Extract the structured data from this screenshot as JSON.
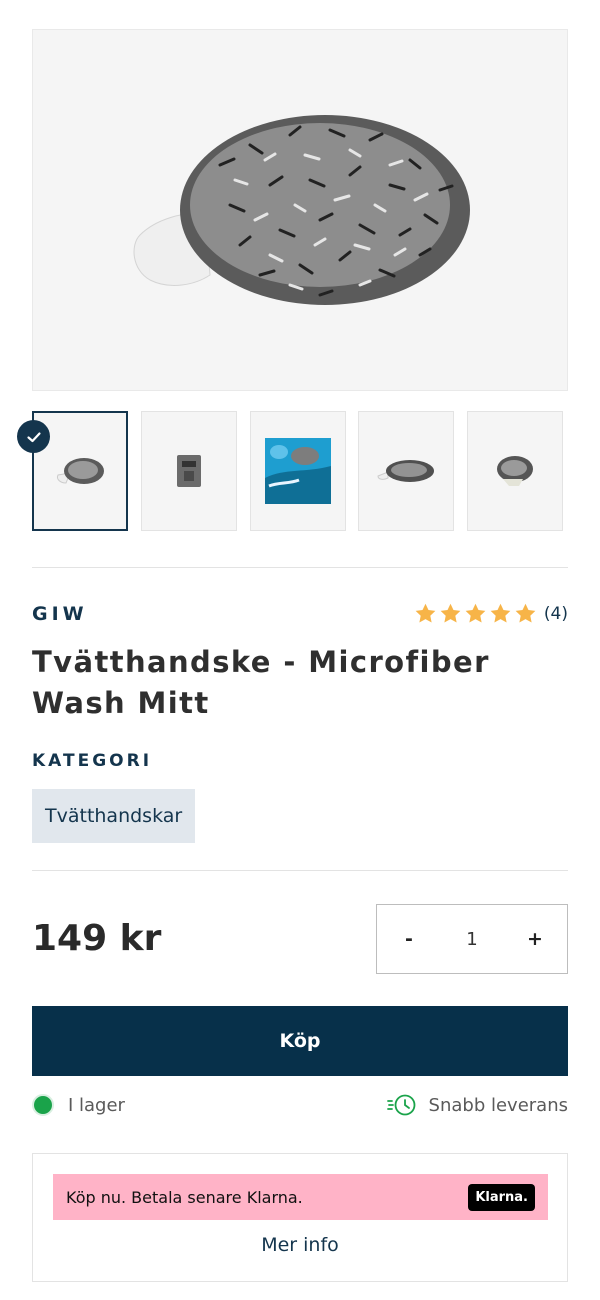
{
  "product": {
    "brand": "GIW",
    "title": "Tvätthandske - Microfiber Wash Mitt",
    "review_count": "(4)",
    "rating": 5,
    "rating_max": 5
  },
  "category": {
    "label": "KATEGORI",
    "tag": "Tvätthandskar"
  },
  "purchase": {
    "price": "149 kr",
    "minus": "-",
    "quantity": "1",
    "plus": "+",
    "buy_label": "Köp"
  },
  "status": {
    "stock": "I lager",
    "delivery": "Snabb leverans"
  },
  "klarna": {
    "message": "Köp nu. Betala senare Klarna.",
    "logo": "Klarna.",
    "more_info": "Mer info"
  },
  "colors": {
    "primary": "#07304a",
    "accent_text": "#14354d",
    "star": "#f7b448",
    "stock_green": "#1aa34a",
    "klarna_pink": "#ffb3c7"
  }
}
